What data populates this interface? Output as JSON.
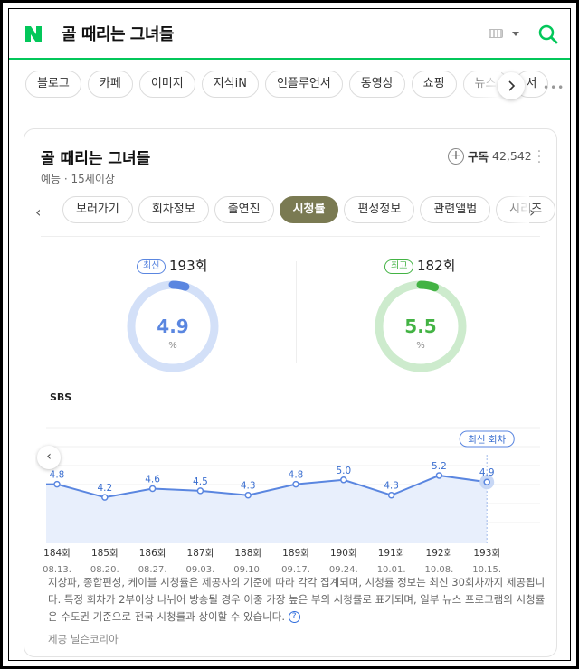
{
  "header": {
    "logo_letter": "N",
    "query": "골 때리는 그녀들",
    "colors": {
      "brand": "#03c75a"
    }
  },
  "tabs": [
    "블로그",
    "카페",
    "이미지",
    "지식iN",
    "인플루언서",
    "동영상",
    "쇼핑",
    "뉴스",
    "서"
  ],
  "card": {
    "title": "골 때리는 그녀들",
    "subtitle": "예능 · 15세이상",
    "subscribe_label": "구독",
    "subscribe_count": "42,542",
    "subtabs": [
      "보러가기",
      "회차정보",
      "출연진",
      "시청률",
      "편성정보",
      "관련앨범",
      "시리즈"
    ],
    "active_subtab": "시청률"
  },
  "latest": {
    "badge": "최신",
    "episode": "193회",
    "value": "4.9",
    "unit": "%",
    "fraction": 0.049,
    "color": "#5a86e0",
    "track": "#d3e0f8"
  },
  "highest": {
    "badge": "최고",
    "episode": "182회",
    "value": "5.5",
    "unit": "%",
    "fraction": 0.055,
    "color": "#43b344",
    "track": "#cdebcd"
  },
  "chart_data": {
    "type": "area",
    "series_label": "SBS",
    "categories": [
      "184회",
      "185회",
      "186회",
      "187회",
      "188회",
      "189회",
      "190회",
      "191회",
      "192회",
      "193회"
    ],
    "dates": [
      "08.13.",
      "08.20.",
      "08.27.",
      "09.03.",
      "09.10.",
      "09.17.",
      "09.24.",
      "10.01.",
      "10.08.",
      "10.15."
    ],
    "values": [
      4.8,
      4.2,
      4.6,
      4.5,
      4.3,
      4.8,
      5.0,
      4.3,
      5.2,
      4.9
    ],
    "value_labels": [
      "4.8",
      "4.2",
      "4.6",
      "4.5",
      "4.3",
      "4.8",
      "5.0",
      "4.3",
      "5.2",
      "4.9"
    ],
    "latest_tag": "최신 회차",
    "line_color": "#5a86e0",
    "fill_color": "#e8effc"
  },
  "note": "지상파, 종합편성, 케이블 시청률은 제공사의 기준에 따라 각각 집계되며, 시청률 정보는 최신 30회차까지 제공됩니다. 특정 회차가 2부이상 나뉘어 방송될 경우 이중 가장 높은 부의 시청률로 표기되며, 일부 뉴스 프로그램의 시청률은 수도권 기준으로 전국 시청률과 상이할 수 있습니다.",
  "help_mark": "?",
  "provider": "제공 닐슨코리아"
}
